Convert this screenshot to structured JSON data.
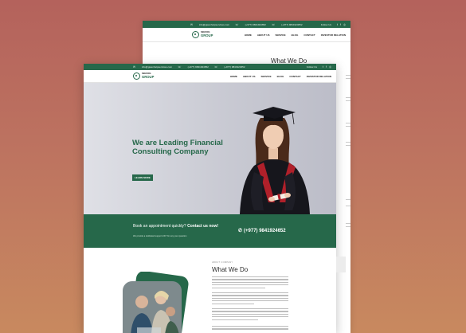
{
  "brand": {
    "small": "NEEDING",
    "big": "GROUP"
  },
  "back_page": {
    "topbar": {
      "email": "info@gwenhelpservices.com",
      "phone": "(+977) 9841924652",
      "phone2": "(+977) 9841924652",
      "follow_label": "Follow Us"
    },
    "nav": [
      "HOME",
      "ABOUT US",
      "SERVICE",
      "BLOG",
      "CONTACT",
      "INVESTOR RELATION"
    ],
    "section_title": "What We Do"
  },
  "front_page": {
    "topbar": {
      "email": "info@gwenhelpservices.com",
      "phone": "(+977) 9841924652",
      "phone2": "(+977) 9841924652",
      "follow_label": "Follow Us"
    },
    "nav": [
      "HOME",
      "ABOUT US",
      "SERVICE",
      "BLOG",
      "CONTACT",
      "INVESTOR RELATION"
    ],
    "hero": {
      "heading": "We are Leading Financial Consulting Company",
      "button": "LEARN MORE"
    },
    "appointment": {
      "title_plain": "Book an appointment quickly?",
      "title_bold": "Contact us now!",
      "subtitle": "We provide a dedicated support 24/7 for any your question",
      "phone": "(+977) 9841924652"
    },
    "what_we_do": {
      "eyebrow": "ABOUT COMPANY",
      "title": "What We Do"
    }
  },
  "colors": {
    "brand_green": "#26684a",
    "background_top": "#b4625c",
    "background_bottom": "#c8895f"
  },
  "icons": [
    "mail-icon",
    "phone-icon",
    "facebook-icon",
    "twitter-icon",
    "instagram-icon",
    "whatsapp-icon",
    "logo-icon"
  ]
}
